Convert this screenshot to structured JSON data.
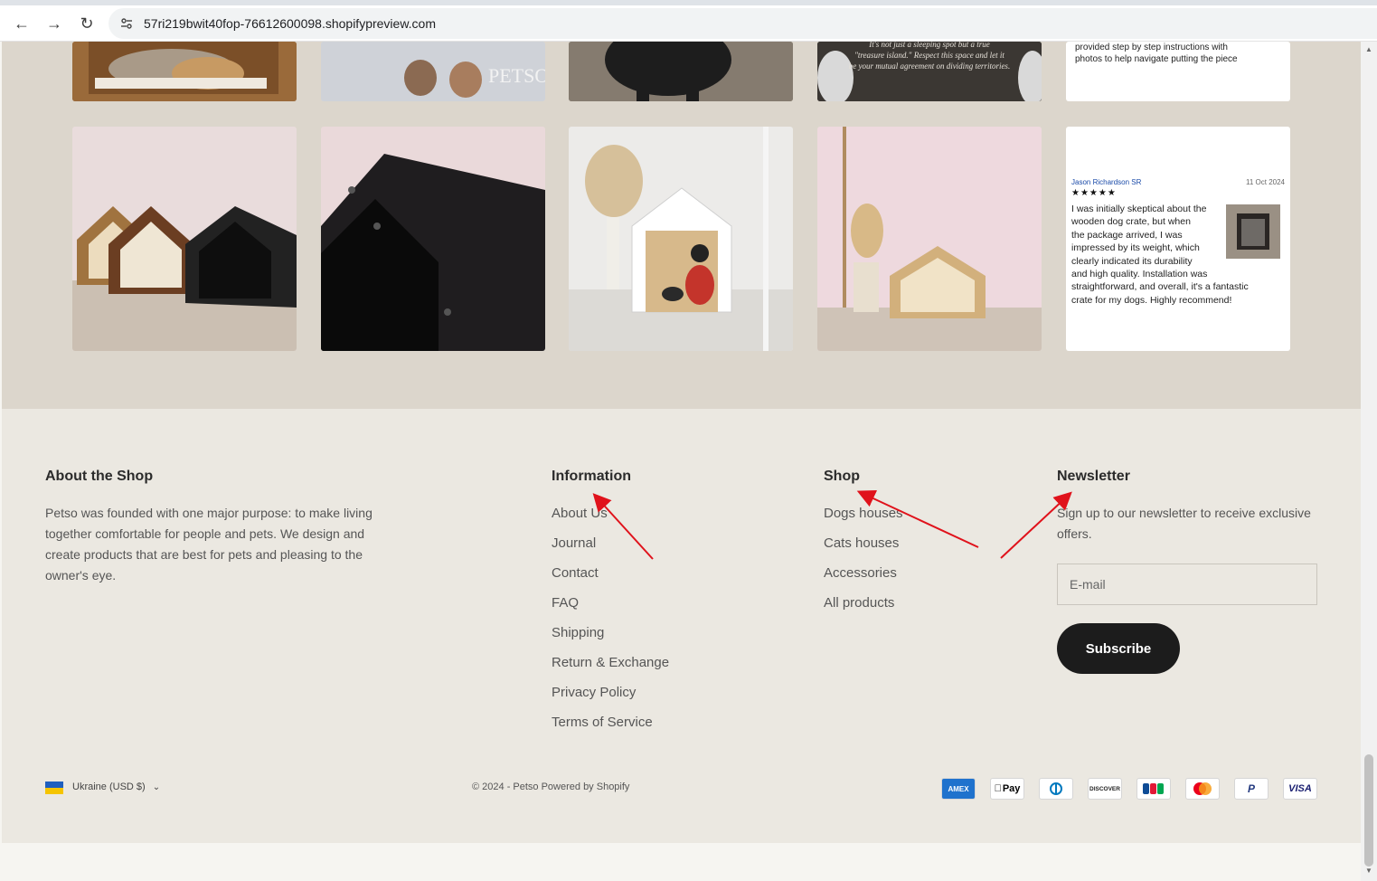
{
  "browser": {
    "url": "57ri219bwit40fop-76612600098.shopifypreview.com"
  },
  "gallery": {
    "top_row": {
      "brand_watermark": "PETSO",
      "quote_line1": "It's not just a sleeping spot but a true",
      "quote_line2": "\"treasure island.\" Respect this space and let it",
      "quote_line3": "be your mutual agreement on dividing territories.",
      "review_line1": "provided step by step instructions with",
      "review_line2": "photos to help navigate putting the piece"
    },
    "review": {
      "author": "Jason Richardson SR",
      "date": "11 Oct 2024",
      "stars": "★★★★★",
      "lines": [
        "I was initially skeptical about the",
        "wooden dog crate, but when",
        "the package arrived, I was",
        "impressed by its weight, which",
        "clearly indicated its durability",
        "and high quality. Installation was",
        "straightforward, and overall, it's a fantastic",
        "crate for my dogs. Highly recommend!"
      ]
    }
  },
  "footer": {
    "about": {
      "title": "About the Shop",
      "line1": "Petso was founded with one major purpose: to make living",
      "line2": "together comfortable for people and pets. We design and",
      "line3": "create products that are best for pets and pleasing to the",
      "line4": "owner's eye."
    },
    "information": {
      "title": "Information",
      "links": [
        "About Us",
        "Journal",
        "Contact",
        "FAQ",
        "Shipping",
        "Return & Exchange",
        "Privacy Policy",
        "Terms of Service"
      ]
    },
    "shop": {
      "title": "Shop",
      "links": [
        "Dogs houses",
        "Cats houses",
        "Accessories",
        "All products"
      ]
    },
    "newsletter": {
      "title": "Newsletter",
      "line1": "Sign up to our newsletter to receive exclusive",
      "line2": "offers.",
      "email_placeholder": "E-mail",
      "subscribe_label": "Subscribe"
    },
    "bottom": {
      "country": "Ukraine (USD $)",
      "copyright": "© 2024 - Petso Powered by Shopify",
      "payment_methods": [
        "AMEX",
        "Pay",
        "DC",
        "DISCOVER",
        "JCB",
        "",
        "P",
        "VISA"
      ]
    }
  },
  "colors": {
    "gallery_bg": "#dcd6cc",
    "footer_bg": "#ebe8e1",
    "button_bg": "#1c1c1c",
    "annotation_arrow": "#e0121b"
  }
}
